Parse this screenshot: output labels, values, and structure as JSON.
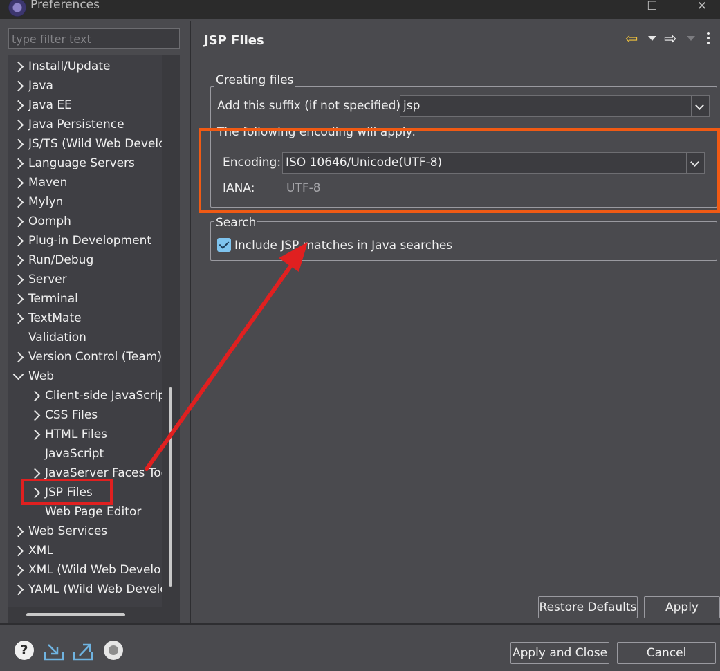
{
  "window": {
    "title": "Preferences"
  },
  "filter": {
    "placeholder": "type filter text"
  },
  "tree": {
    "items": [
      {
        "label": "Install/Update",
        "level": 0,
        "expander": "collapsed"
      },
      {
        "label": "Java",
        "level": 0,
        "expander": "collapsed"
      },
      {
        "label": "Java EE",
        "level": 0,
        "expander": "collapsed"
      },
      {
        "label": "Java Persistence",
        "level": 0,
        "expander": "collapsed"
      },
      {
        "label": "JS/TS (Wild Web Develo",
        "level": 0,
        "expander": "collapsed"
      },
      {
        "label": "Language Servers",
        "level": 0,
        "expander": "collapsed"
      },
      {
        "label": "Maven",
        "level": 0,
        "expander": "collapsed"
      },
      {
        "label": "Mylyn",
        "level": 0,
        "expander": "collapsed"
      },
      {
        "label": "Oomph",
        "level": 0,
        "expander": "collapsed"
      },
      {
        "label": "Plug-in Development",
        "level": 0,
        "expander": "collapsed"
      },
      {
        "label": "Run/Debug",
        "level": 0,
        "expander": "collapsed"
      },
      {
        "label": "Server",
        "level": 0,
        "expander": "collapsed"
      },
      {
        "label": "Terminal",
        "level": 0,
        "expander": "collapsed"
      },
      {
        "label": "TextMate",
        "level": 0,
        "expander": "collapsed"
      },
      {
        "label": "Validation",
        "level": 0,
        "expander": "none"
      },
      {
        "label": "Version Control (Team)",
        "level": 0,
        "expander": "collapsed"
      },
      {
        "label": "Web",
        "level": 0,
        "expander": "expanded"
      },
      {
        "label": "Client-side JavaScript",
        "level": 1,
        "expander": "collapsed"
      },
      {
        "label": "CSS Files",
        "level": 1,
        "expander": "collapsed"
      },
      {
        "label": "HTML Files",
        "level": 1,
        "expander": "collapsed"
      },
      {
        "label": "JavaScript",
        "level": 1,
        "expander": "none"
      },
      {
        "label": "JavaServer Faces Too",
        "level": 1,
        "expander": "collapsed"
      },
      {
        "label": "JSP Files",
        "level": 1,
        "expander": "collapsed",
        "selected": true
      },
      {
        "label": "Web Page Editor",
        "level": 1,
        "expander": "none"
      },
      {
        "label": "Web Services",
        "level": 0,
        "expander": "collapsed"
      },
      {
        "label": "XML",
        "level": 0,
        "expander": "collapsed"
      },
      {
        "label": "XML (Wild Web Develop",
        "level": 0,
        "expander": "collapsed"
      },
      {
        "label": "YAML (Wild Web Develo",
        "level": 0,
        "expander": "collapsed"
      }
    ]
  },
  "page": {
    "title": "JSP Files",
    "creating_group": {
      "label": "Creating files",
      "suffix_label": "Add this suffix (if not specified):",
      "suffix_value": "jsp",
      "encoding_caption": "The following encoding will apply:",
      "encoding_label": "Encoding:",
      "encoding_value": "ISO 10646/Unicode(UTF-8)",
      "iana_label": "IANA:",
      "iana_value": "UTF-8"
    },
    "search_group": {
      "label": "Search",
      "include_label": "Include JSP matches in Java searches",
      "include_checked": true
    }
  },
  "buttons": {
    "restore_defaults": "Restore Defaults",
    "apply": "Apply",
    "apply_and_close": "Apply and Close",
    "cancel": "Cancel"
  },
  "icons": [
    "app-icon",
    "back-icon",
    "forward-icon",
    "view-menu-icon",
    "help-icon",
    "import-icon",
    "export-icon",
    "oomph-icon"
  ],
  "colors": {
    "background": "#4a4a4e",
    "tree_background": "#3f3f44",
    "checkbox": "#7fc4ef",
    "encoding_highlight": "#f05a14",
    "annotation_red": "#e02020"
  }
}
